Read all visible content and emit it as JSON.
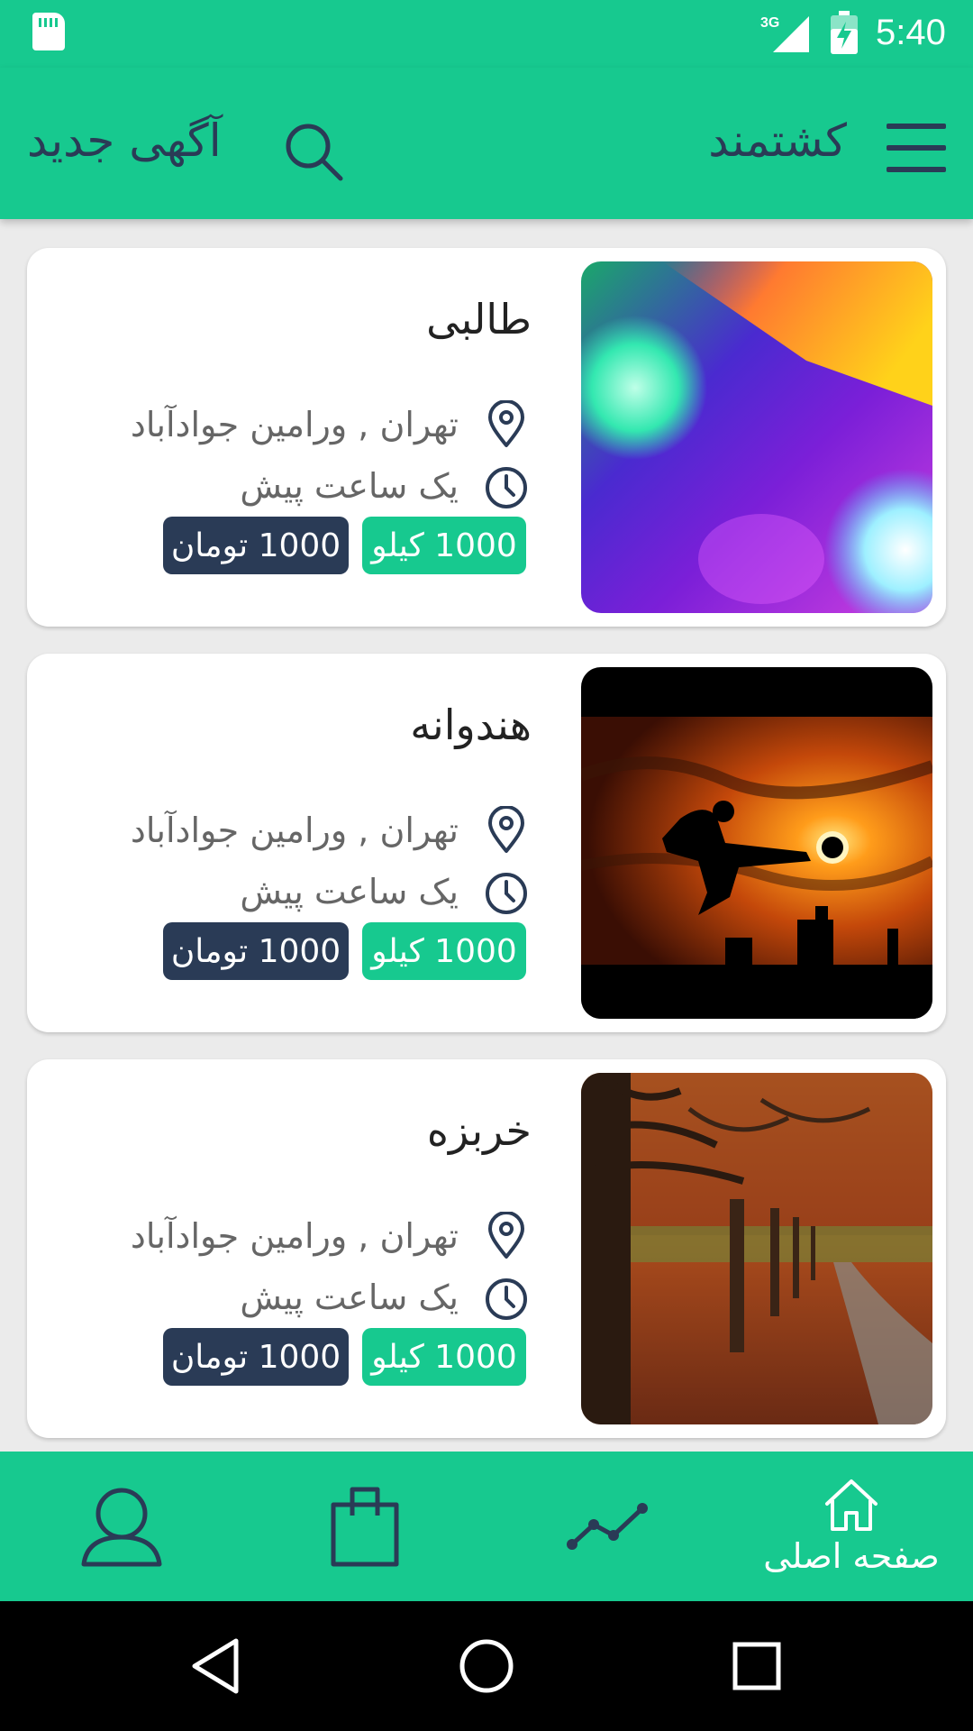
{
  "status_bar": {
    "time": "5:40",
    "network": "3G"
  },
  "app_bar": {
    "title": "کشتمند",
    "new_ad_label": "آگهی جدید"
  },
  "listings": [
    {
      "title": "طالبی",
      "location": "تهران , ورامین جوادآباد",
      "time_ago": "یک ساعت پیش",
      "weight_tag": "1000 کیلو",
      "price_tag": "1000 تومان"
    },
    {
      "title": "هندوانه",
      "location": "تهران , ورامین جوادآباد",
      "time_ago": "یک ساعت پیش",
      "weight_tag": "1000 کیلو",
      "price_tag": "1000 تومان"
    },
    {
      "title": "خربزه",
      "location": "تهران , ورامین جوادآباد",
      "time_ago": "یک ساعت پیش",
      "weight_tag": "1000 کیلو",
      "price_tag": "1000 تومان"
    }
  ],
  "bottom_nav": {
    "home_label": "صفحه اصلی"
  },
  "icons": [
    "menu-icon",
    "search-icon",
    "location-pin-icon",
    "clock-icon",
    "home-icon",
    "chart-icon",
    "shopping-bag-icon",
    "user-icon"
  ],
  "colors": {
    "primary": "#17c98f",
    "dark": "#2a3b56",
    "background": "#ebebeb"
  }
}
